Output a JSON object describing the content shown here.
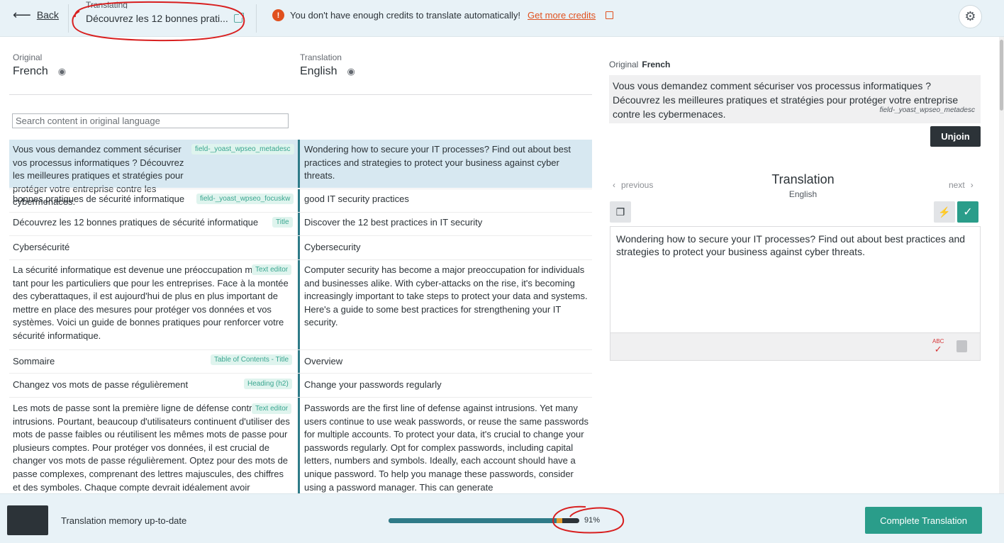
{
  "topbar": {
    "back_label": "Back",
    "translating_label": "Translating",
    "document_title": "Découvrez les 12 bonnes prati...",
    "alert_text": "You don't have enough credits to translate automatically!",
    "alert_link": "Get more credits"
  },
  "columns": {
    "original_label": "Original",
    "original_lang": "French",
    "translation_label": "Translation",
    "translation_lang": "English"
  },
  "search": {
    "placeholder": "Search content in original language"
  },
  "rows": [
    {
      "original": "Vous vous demandez comment sécuriser vos processus informatiques ? Découvrez les meilleures pratiques et stratégies pour protéger votre entreprise contre les cybermenaces.",
      "tag": "field-_yoast_wpseo_metadesc",
      "translation": "Wondering how to secure your IT processes? Find out about best practices and strategies to protect your business against cyber threats."
    },
    {
      "original": "bonnes pratiques de sécurité informatique",
      "tag": "field-_yoast_wpseo_focuskw",
      "translation": "good IT security practices"
    },
    {
      "original": "Découvrez les 12 bonnes pratiques de sécurité informatique",
      "tag": "Title",
      "translation": "Discover the 12 best practices in IT security"
    },
    {
      "original": "Cybersécurité",
      "tag": "",
      "translation": "Cybersecurity"
    },
    {
      "original": "La sécurité informatique est devenue une préoccupation majeure, tant pour les particuliers que pour les entreprises. Face à la montée des cyberattaques, il est aujourd'hui de plus en plus important de mettre en place des mesures pour protéger vos données et vos systèmes. Voici un guide de bonnes pratiques pour renforcer votre sécurité informatique.",
      "tag": "Text editor",
      "translation": "Computer security has become a major preoccupation for individuals and businesses alike. With cyber-attacks on the rise, it's becoming increasingly important to take steps to protect your data and systems. Here's a guide to some best practices for strengthening your IT security."
    },
    {
      "original": "Sommaire",
      "tag": "Table of Contents - Title",
      "translation": "Overview"
    },
    {
      "original": "Changez vos mots de passe régulièrement",
      "tag": "Heading (h2)",
      "translation": "Change your passwords regularly"
    },
    {
      "original": "Les mots de passe sont la première ligne de défense contre les intrusions. Pourtant, beaucoup d'utilisateurs continuent d'utiliser des mots de passe faibles ou réutilisent les mêmes mots de passe pour plusieurs comptes. Pour protéger vos données, il est crucial de changer vos mots de passe régulièrement. Optez pour des mots de passe complexes, comprenant des lettres majuscules, des chiffres et des symboles. Chaque compte devrait idéalement avoir",
      "tag": "Text editor",
      "translation": "Passwords are the first line of defense against intrusions. Yet many users continue to use weak passwords, or reuse the same passwords for multiple accounts. To protect your data, it's crucial to change your passwords regularly. Opt for complex passwords, including capital letters, numbers and symbols. Ideally, each account should have a unique password. To help you manage these passwords, consider using a password manager. This can generate"
    }
  ],
  "panel": {
    "original_label": "Original",
    "original_lang": "French",
    "original_text": "Vous vous demandez comment sécuriser vos processus informatiques ? Découvrez les meilleures pratiques et stratégies pour protéger votre entreprise contre les cybermenaces.",
    "original_meta": "field-_yoast_wpseo_metadesc",
    "unjoin_label": "Unjoin",
    "previous_label": "previous",
    "next_label": "next",
    "translation_title": "Translation",
    "translation_lang": "English",
    "translation_text": "Wondering how to secure your IT processes? Find out about best practices and strategies to protect your business against cyber threats.",
    "spell_label": "ABC"
  },
  "bottom": {
    "memory_status": "Translation memory up-to-date",
    "progress_fraction": 0.91,
    "progress_label": "91%",
    "complete_label": "Complete Translation"
  },
  "colors": {
    "accent": "#2a9d8a",
    "progress": "#2f7b88",
    "alert": "#e0511f",
    "annotation": "#d81f1f"
  },
  "icons": {
    "back": "arrow-left-icon",
    "external": "external-link-icon",
    "alert": "exclamation-icon",
    "settings": "gear-icon",
    "visibility": "eye-slash-icon",
    "copy": "copy-icon",
    "auto_translate": "bolt-icon",
    "confirm": "check-icon",
    "spellcheck": "spellcheck-icon",
    "glossary": "glossary-icon"
  }
}
